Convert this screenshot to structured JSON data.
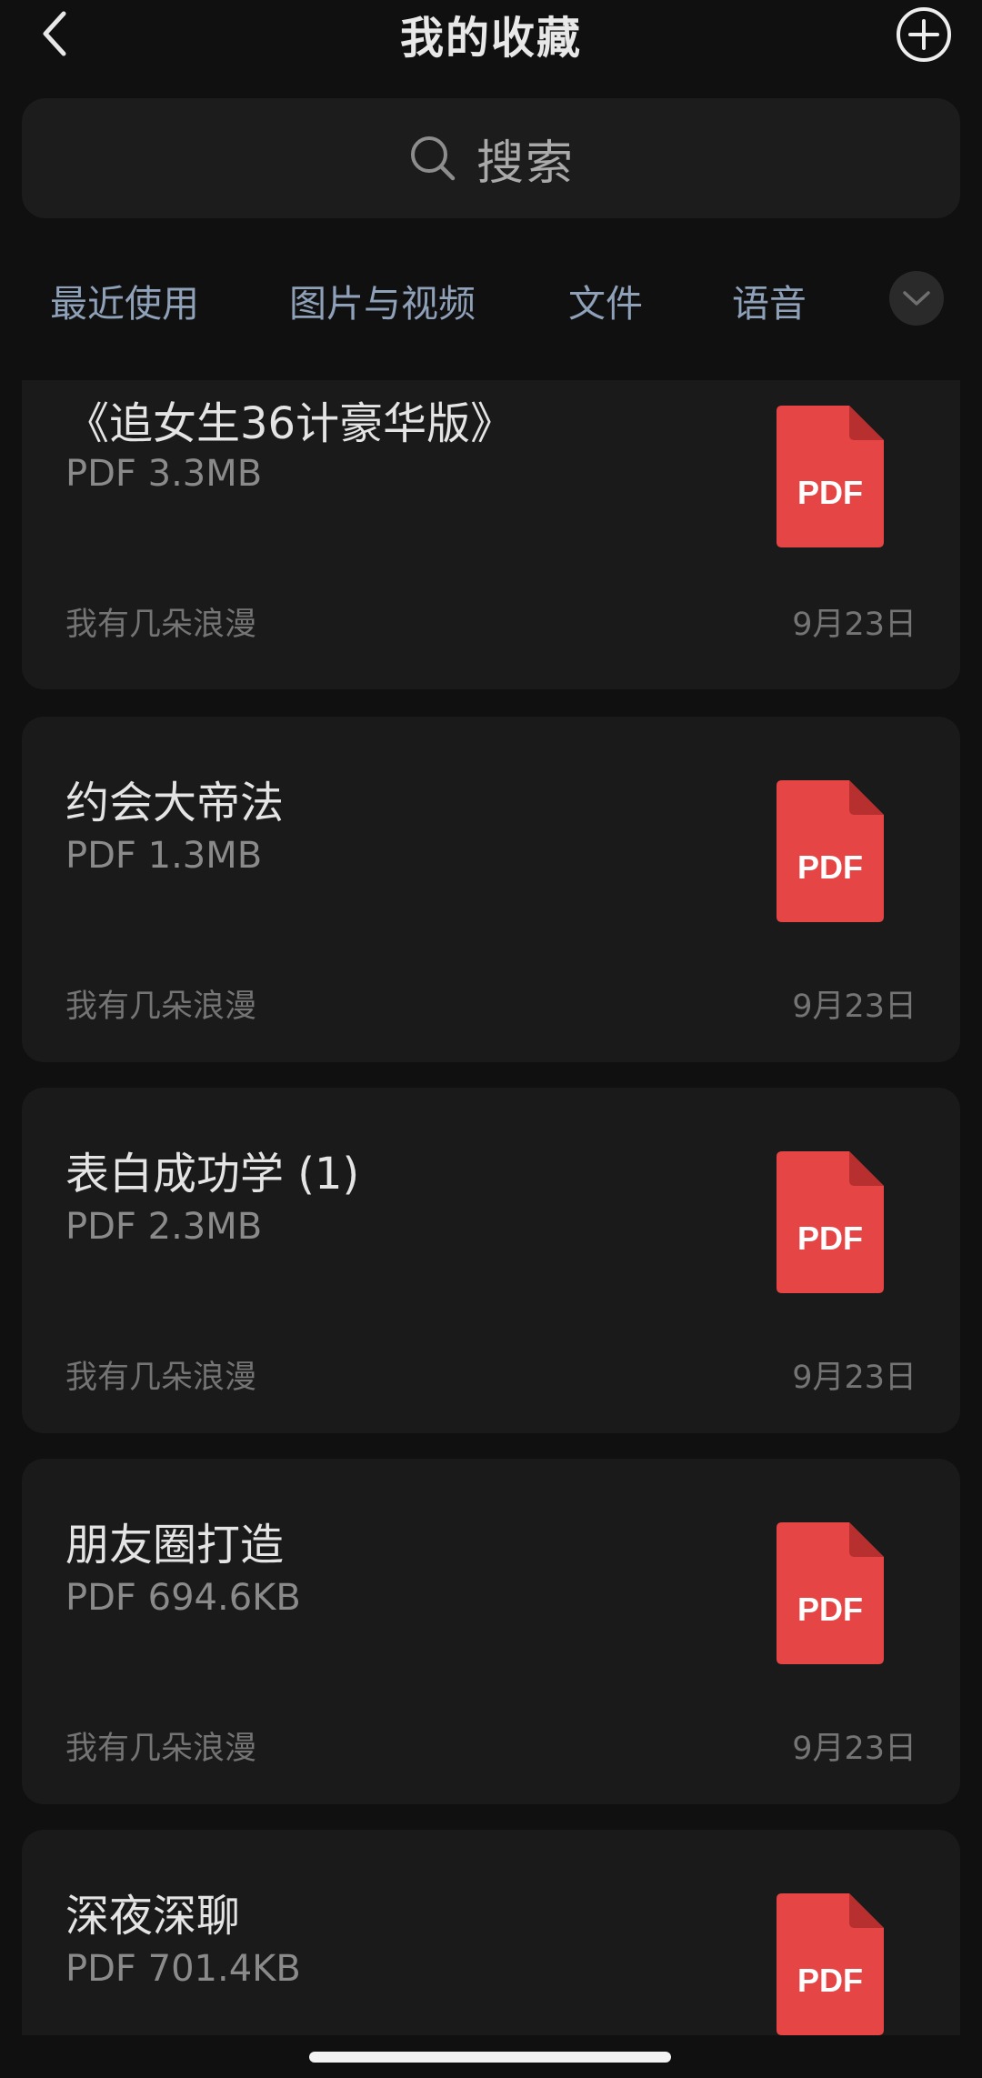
{
  "header": {
    "title": "我的收藏",
    "back_icon": "chevron-left-icon",
    "add_icon": "plus-circle-icon"
  },
  "search": {
    "icon": "search-icon",
    "placeholder": "搜索"
  },
  "tabs": [
    {
      "label": "最近使用"
    },
    {
      "label": "图片与视频"
    },
    {
      "label": "文件"
    },
    {
      "label": "语音"
    }
  ],
  "tabs_more_icon": "chevron-down-icon",
  "items": [
    {
      "title": "《追女生36计豪华版》",
      "meta": "PDF 3.3MB",
      "source": "我有几朵浪漫",
      "date": "9月23日",
      "file_type": "PDF"
    },
    {
      "title": "约会大帝法",
      "meta": "PDF 1.3MB",
      "source": "我有几朵浪漫",
      "date": "9月23日",
      "file_type": "PDF"
    },
    {
      "title": "表白成功学 (1)",
      "meta": "PDF 2.3MB",
      "source": "我有几朵浪漫",
      "date": "9月23日",
      "file_type": "PDF"
    },
    {
      "title": "朋友圈打造",
      "meta": "PDF 694.6KB",
      "source": "我有几朵浪漫",
      "date": "9月23日",
      "file_type": "PDF"
    },
    {
      "title": "深夜深聊",
      "meta": "PDF 701.4KB",
      "source": "",
      "date": "",
      "file_type": "PDF"
    }
  ],
  "colors": {
    "background": "#101010",
    "card": "#1a1a1a",
    "tab_text": "#8ea1b8",
    "pdf_red": "#e64545"
  }
}
